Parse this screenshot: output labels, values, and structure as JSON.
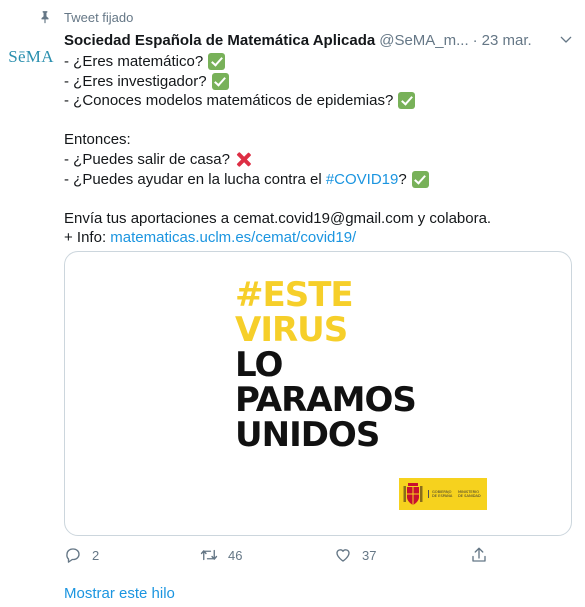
{
  "pinned": {
    "label": "Tweet fijado",
    "icon": "pin-icon"
  },
  "author": {
    "avatar_text": "SēMA",
    "name": "Sociedad Española de Matemática Aplicada",
    "handle": "@SeMA_m...",
    "separator": "·",
    "date": "23 mar."
  },
  "tweet": {
    "lines": [
      "- ¿Eres matemático?",
      "- ¿Eres investigador?",
      "- ¿Conoces modelos matemáticos de epidemias?",
      "Entonces:",
      "- ¿Puedes salir de casa?",
      "- ¿Puedes ayudar en la lucha contra el ",
      "?",
      "Envía tus aportaciones a cemat.covid19@gmail.com y colabora.",
      "+ Info: "
    ],
    "hashtag": "#COVID19",
    "link": "matematicas.uclm.es/cemat/covid19/"
  },
  "media": {
    "campaign_lines": [
      "#ESTE",
      "VIRUS",
      "LO",
      "PARAMOS",
      "UNIDOS"
    ],
    "logo_label_1": "GOBIERNO DE ESPAÑA",
    "logo_label_2": "MINISTERIO DE SANIDAD",
    "colors": {
      "yellow": "#f6cf2a",
      "black": "#111111",
      "logo_yellow": "#f6d21e"
    }
  },
  "actions": {
    "reply_count": "2",
    "retweet_count": "46",
    "like_count": "37"
  },
  "show_thread_label": "Mostrar este hilo",
  "colors": {
    "text": "#14171a",
    "secondary": "#657786",
    "link": "#1b95e0",
    "check": "#78b159",
    "cross": "#dd2e44"
  }
}
